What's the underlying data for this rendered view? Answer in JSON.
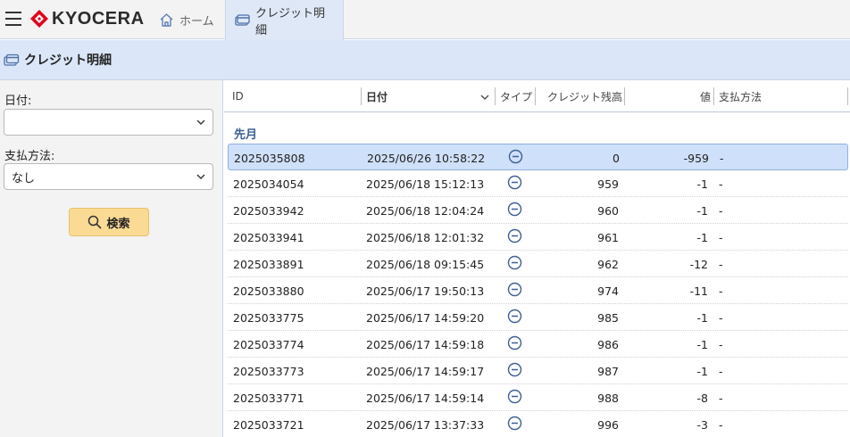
{
  "brand": "KYOCERA",
  "tabs": [
    {
      "label": "ホーム",
      "icon": "home-icon",
      "active": false
    },
    {
      "label": "クレジット明細",
      "icon": "credit-card-icon",
      "active": true
    }
  ],
  "page_title": "クレジット明細",
  "filters": {
    "date_label": "日付:",
    "date_value": "",
    "payment_label": "支払方法:",
    "payment_value": "なし",
    "search_label": "検索"
  },
  "table": {
    "columns": [
      "ID",
      "日付",
      "タイプ",
      "クレジット残高",
      "値",
      "支払方法"
    ],
    "sort_column": "日付",
    "group": "先月",
    "rows": [
      {
        "id": "2025035808",
        "date": "2025/06/26 10:58:22",
        "type": "minus-icon",
        "balance": "0",
        "value": "-959",
        "payment": "-",
        "selected": true
      },
      {
        "id": "2025034054",
        "date": "2025/06/18 15:12:13",
        "type": "minus-icon",
        "balance": "959",
        "value": "-1",
        "payment": "-"
      },
      {
        "id": "2025033942",
        "date": "2025/06/18 12:04:24",
        "type": "minus-icon",
        "balance": "960",
        "value": "-1",
        "payment": "-"
      },
      {
        "id": "2025033941",
        "date": "2025/06/18 12:01:32",
        "type": "minus-icon",
        "balance": "961",
        "value": "-1",
        "payment": "-"
      },
      {
        "id": "2025033891",
        "date": "2025/06/18 09:15:45",
        "type": "minus-icon",
        "balance": "962",
        "value": "-12",
        "payment": "-"
      },
      {
        "id": "2025033880",
        "date": "2025/06/17 19:50:13",
        "type": "minus-icon",
        "balance": "974",
        "value": "-11",
        "payment": "-"
      },
      {
        "id": "2025033775",
        "date": "2025/06/17 14:59:20",
        "type": "minus-icon",
        "balance": "985",
        "value": "-1",
        "payment": "-"
      },
      {
        "id": "2025033774",
        "date": "2025/06/17 14:59:18",
        "type": "minus-icon",
        "balance": "986",
        "value": "-1",
        "payment": "-"
      },
      {
        "id": "2025033773",
        "date": "2025/06/17 14:59:17",
        "type": "minus-icon",
        "balance": "987",
        "value": "-1",
        "payment": "-"
      },
      {
        "id": "2025033771",
        "date": "2025/06/17 14:59:14",
        "type": "minus-icon",
        "balance": "988",
        "value": "-8",
        "payment": "-"
      },
      {
        "id": "2025033721",
        "date": "2025/06/17 13:37:33",
        "type": "minus-icon",
        "balance": "996",
        "value": "-3",
        "payment": "-"
      }
    ]
  },
  "colors": {
    "accent": "#3d5f94",
    "header_bg": "#dbe7f8",
    "search_button": "#fbdb94",
    "selected_row": "#cfe0fa",
    "logo_red": "#e2001a"
  }
}
